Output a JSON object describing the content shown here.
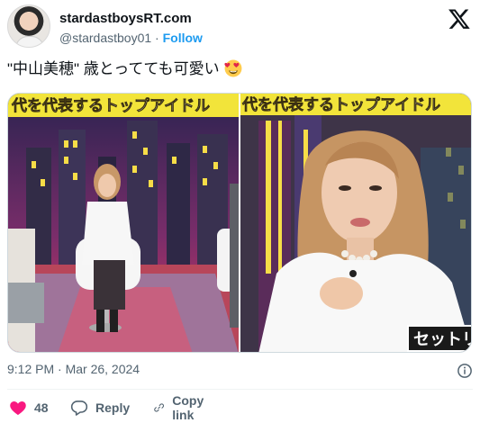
{
  "author": {
    "display_name": "stardastboysRT.com",
    "handle": "@stardastboy01",
    "separator": "·",
    "follow_label": "Follow"
  },
  "tweet": {
    "text": "\"中山美穂\" 歳とってても可愛い",
    "emoji": "smiling-face-with-heart-eyes"
  },
  "media": {
    "left_banner": "代を代表するトップアイドル",
    "right_banner": "代を代表するトップアイドル",
    "caption_badge": "セットリ"
  },
  "timestamp": "9:12 PM · Mar 26, 2024",
  "actions": {
    "likes_count": "48",
    "reply_label": "Reply",
    "copy_link_label": "Copy link"
  },
  "colors": {
    "accent": "#1d9bf0",
    "like": "#f91880",
    "text": "#0f1419",
    "muted": "#536471",
    "banner_text": "#ffffff",
    "banner_bg": "#f2e43a"
  }
}
